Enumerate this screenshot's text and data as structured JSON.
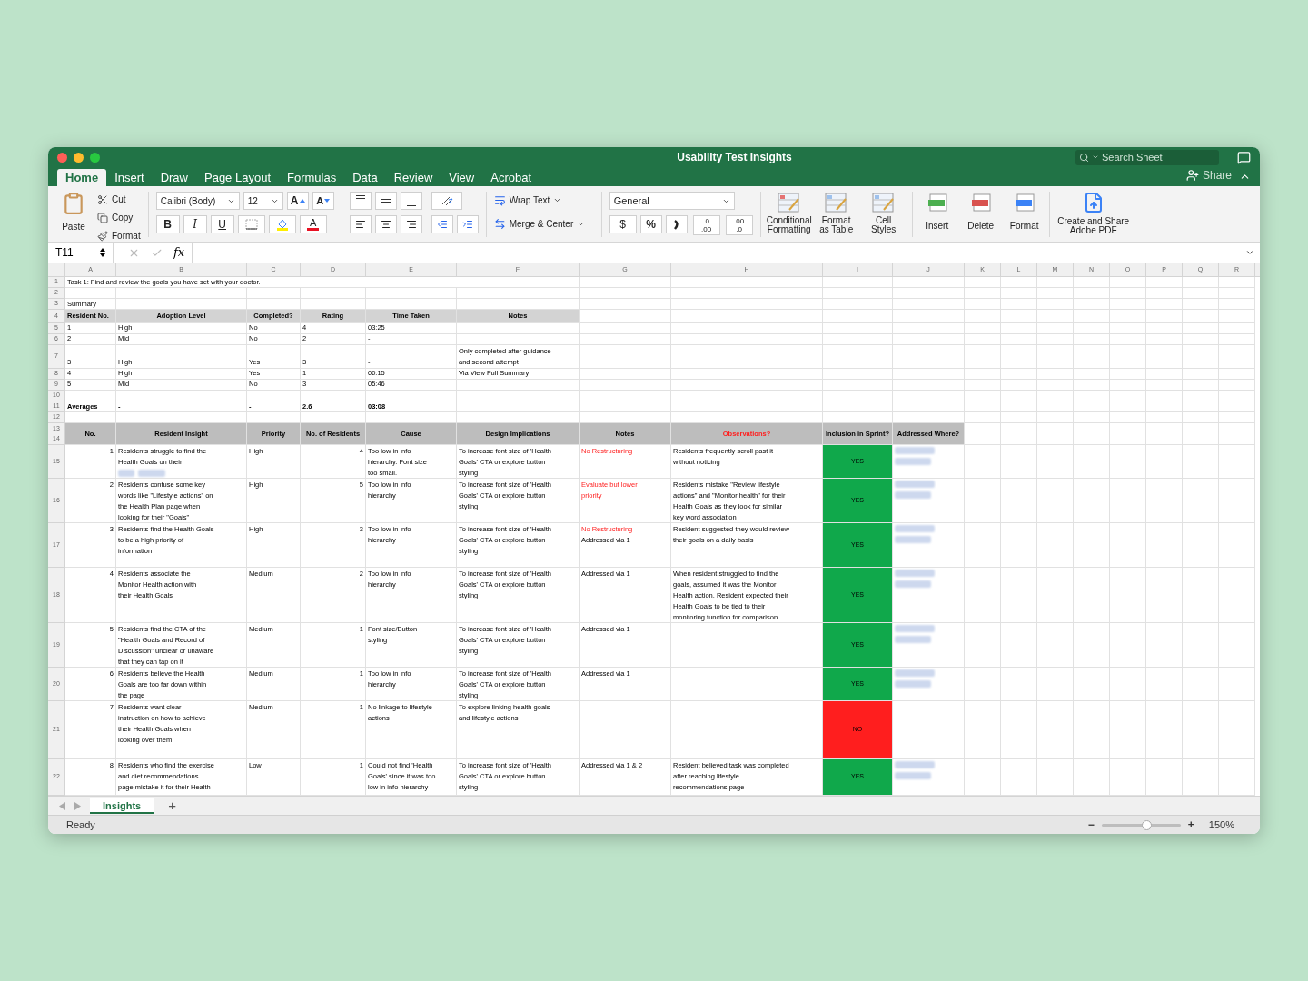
{
  "window": {
    "title": "Usability Test Insights"
  },
  "search": {
    "placeholder": "Search Sheet"
  },
  "share": {
    "label": "Share"
  },
  "tabs": [
    {
      "label": "Home",
      "selected": true
    },
    {
      "label": "Insert",
      "selected": false
    },
    {
      "label": "Draw",
      "selected": false
    },
    {
      "label": "Page Layout",
      "selected": false
    },
    {
      "label": "Formulas",
      "selected": false
    },
    {
      "label": "Data",
      "selected": false
    },
    {
      "label": "Review",
      "selected": false
    },
    {
      "label": "View",
      "selected": false
    },
    {
      "label": "Acrobat",
      "selected": false
    }
  ],
  "ribbon": {
    "paste": "Paste",
    "clipboard": [
      "Cut",
      "Copy",
      "Format"
    ],
    "font_name": "Calibri (Body)",
    "font_size": "12",
    "grow_font": "A",
    "shrink_font": "A",
    "format_buttons": [
      "B",
      "I",
      "U"
    ],
    "font_color": "A",
    "wrap_text": "Wrap Text",
    "merge": "Merge & Center",
    "number_format": "General",
    "number_buttons": [
      "$",
      "%"
    ],
    "decimal_buttons": [
      [
        ".0",
        ".00"
      ],
      [
        ".00",
        ".0"
      ]
    ],
    "style_buttons": [
      [
        "Conditional",
        "Formatting"
      ],
      [
        "Format",
        "as Table"
      ],
      [
        "Cell",
        "Styles"
      ]
    ],
    "cell_buttons": [
      "Insert",
      "Delete",
      "Format"
    ],
    "pdf": [
      "Create and Share",
      "Adobe PDF"
    ]
  },
  "formula_bar": {
    "cell": "T11",
    "fx": "fx"
  },
  "columns": [
    "A",
    "B",
    "C",
    "D",
    "E",
    "F",
    "G",
    "H",
    "I",
    "J",
    "K",
    "L",
    "M",
    "N",
    "O",
    "P",
    "Q",
    "R"
  ],
  "row_numbers": [
    "1",
    "2",
    "3",
    "4",
    "5",
    "6",
    "7",
    "8",
    "9",
    "10",
    "11",
    "12",
    "13",
    "14",
    "15",
    "16",
    "17",
    "18",
    "19",
    "20",
    "21",
    "22"
  ],
  "task": "Task 1: Find and review the goals you have set with your doctor.",
  "summary": {
    "title": "Summary",
    "columns": [
      "Resident No.",
      "Adoption Level",
      "Completed?",
      "Rating",
      "Time Taken",
      "Notes"
    ],
    "rows": [
      {
        "cells": [
          "1",
          "High",
          "No",
          "4",
          "03:25"
        ]
      },
      {
        "cells": [
          "2",
          "Mid",
          "No",
          "2",
          "-"
        ]
      },
      {
        "cells": [
          "3",
          "High",
          "Yes",
          "3",
          "-"
        ],
        "notes": [
          "Only completed after guidance",
          "and second attempt"
        ]
      },
      {
        "cells": [
          "4",
          "High",
          "Yes",
          "1",
          "00:15"
        ],
        "notes": [
          "Via View Full Summary"
        ]
      },
      {
        "cells": [
          "5",
          "Mid",
          "No",
          "3",
          "05:46"
        ]
      }
    ],
    "averages": [
      "Averages",
      "-",
      "-",
      "2.6",
      "03:08"
    ]
  },
  "insights": {
    "columns": [
      {
        "label": "No.",
        "flagged": false
      },
      {
        "label": "Resident Insight",
        "flagged": false
      },
      {
        "label": "Priority",
        "flagged": false
      },
      {
        "label": "No. of Residents",
        "flagged": false
      },
      {
        "label": "Cause",
        "flagged": false
      },
      {
        "label": "Design Implications",
        "flagged": false
      },
      {
        "label": "Notes",
        "flagged": false
      },
      {
        "label": "Observations?",
        "flagged": true
      },
      {
        "label": "Inclusion in Sprint?",
        "flagged": false
      },
      {
        "label": "Addressed Where?",
        "flagged": false
      }
    ],
    "rows": [
      {
        "no": "1",
        "insight": [
          "Residents struggle to find the",
          "Health Goals on their"
        ],
        "insight_redacted": true,
        "priority": "High",
        "residents": "4",
        "cause": [
          "Too low in info",
          "hierarchy. Font size",
          "too small."
        ],
        "implications": [
          "To increase font size of 'Health",
          "Goals' CTA or explore button",
          "styling"
        ],
        "notes": [
          {
            "text": "No Restructuring",
            "flagged": true
          }
        ],
        "observations": [
          "Residents frequently scroll past it",
          "without noticing"
        ],
        "inclusion": {
          "text": "YES",
          "color": "#10a84b"
        },
        "redacted": true
      },
      {
        "no": "2",
        "insight": [
          "Residents confuse some key",
          "words like \"Lifestyle actions\" on",
          "the Health Plan page when",
          "looking for their \"Goals\""
        ],
        "priority": "High",
        "residents": "5",
        "cause": [
          "Too low in info",
          "hierarchy"
        ],
        "implications": [
          "To increase font size of 'Health",
          "Goals' CTA or explore button",
          "styling"
        ],
        "notes": [
          {
            "text": "Evaluate but lower",
            "flagged": true
          },
          {
            "text": "priority",
            "flagged": true
          }
        ],
        "observations": [
          "Residents mistake \"Review lifestyle",
          "actions\" and \"Monitor health\" for their",
          "Health Goals as they look for similar",
          "key word association"
        ],
        "inclusion": {
          "text": "YES",
          "color": "#10a84b"
        },
        "redacted": true
      },
      {
        "no": "3",
        "insight": [
          "Residents find the Health Goals",
          "to be a high priority of",
          "information"
        ],
        "priority": "High",
        "residents": "3",
        "cause": [
          "Too low in info",
          "hierarchy"
        ],
        "implications": [
          "To increase font size of 'Health",
          "Goals' CTA or explore button",
          "styling"
        ],
        "notes": [
          {
            "text": "No Restructuring",
            "flagged": true
          },
          {
            "text": "Addressed via 1",
            "flagged": false
          }
        ],
        "observations": [
          "Resident suggested they would review",
          "their goals on a daily basis"
        ],
        "inclusion": {
          "text": "YES",
          "color": "#10a84b"
        },
        "redacted": true
      },
      {
        "no": "4",
        "insight": [
          "Residents associate the",
          "Monitor Health action with",
          "their Health Goals"
        ],
        "priority": "Medium",
        "residents": "2",
        "cause": [
          "Too low in info",
          "hierarchy"
        ],
        "implications": [
          "To increase font size of 'Health",
          "Goals' CTA or explore button",
          "styling"
        ],
        "notes": [
          {
            "text": "Addressed via 1",
            "flagged": false
          }
        ],
        "observations": [
          "When resident struggled to find the",
          "goals, assumed it was the Monitor",
          "Health action. Resident expected their",
          "Health Goals to be tied to their",
          "monitoring function for comparison."
        ],
        "inclusion": {
          "text": "YES",
          "color": "#10a84b"
        },
        "redacted": true
      },
      {
        "no": "5",
        "insight": [
          "Residents find the CTA of the",
          "\"Health Goals and Record of",
          "Discussion\" unclear or unaware",
          "that they can tap on it"
        ],
        "priority": "Medium",
        "residents": "1",
        "cause": [
          "Font size/Button",
          "styling"
        ],
        "implications": [
          "To increase font size of 'Health",
          "Goals' CTA or explore button",
          "styling"
        ],
        "notes": [
          {
            "text": "Addressed via 1",
            "flagged": false
          }
        ],
        "inclusion": {
          "text": "YES",
          "color": "#10a84b"
        },
        "redacted": true
      },
      {
        "no": "6",
        "insight": [
          "Residents believe the Health",
          "Goals are too far down within",
          "the page"
        ],
        "priority": "Medium",
        "residents": "1",
        "cause": [
          "Too low in info",
          "hierarchy"
        ],
        "implications": [
          "To increase font size of 'Health",
          "Goals' CTA or explore button",
          "styling"
        ],
        "notes": [
          {
            "text": "Addressed via 1",
            "flagged": false
          }
        ],
        "inclusion": {
          "text": "YES",
          "color": "#10a84b"
        },
        "redacted": true
      },
      {
        "no": "7",
        "insight": [
          "Residents want clear",
          "instruction on how to achieve",
          "their Health Goals when",
          "looking over them"
        ],
        "priority": "Medium",
        "residents": "1",
        "cause": [
          "No linkage to lifestyle",
          "actions"
        ],
        "implications": [
          "To explore linking health goals",
          "and lifestyle actions"
        ],
        "inclusion": {
          "text": "NO",
          "color": "#ff1e1e"
        }
      },
      {
        "no": "8",
        "insight": [
          "Residents who find the exercise",
          "and diet recommendations",
          "page mistake it for their Health"
        ],
        "priority": "Low",
        "residents": "1",
        "cause": [
          "Could not find 'Health",
          "Goals' since it was too",
          "low in info hierarchy"
        ],
        "implications": [
          "To increase font size of 'Health",
          "Goals' CTA or explore button",
          "styling"
        ],
        "notes": [
          {
            "text": "Addressed via 1 & 2",
            "flagged": false
          }
        ],
        "observations": [
          "Resident believed task was completed",
          "after reaching lifestyle",
          "recommendations page"
        ],
        "inclusion": {
          "text": "YES",
          "color": "#10a84b"
        },
        "redacted": true
      }
    ]
  },
  "sheet_tabs": [
    {
      "label": "Insights",
      "selected": true
    }
  ],
  "add_sheet": "+",
  "status": {
    "text": "Ready",
    "zoom_out": "−",
    "zoom_in": "+",
    "level": 0.56,
    "reading": "150%"
  }
}
